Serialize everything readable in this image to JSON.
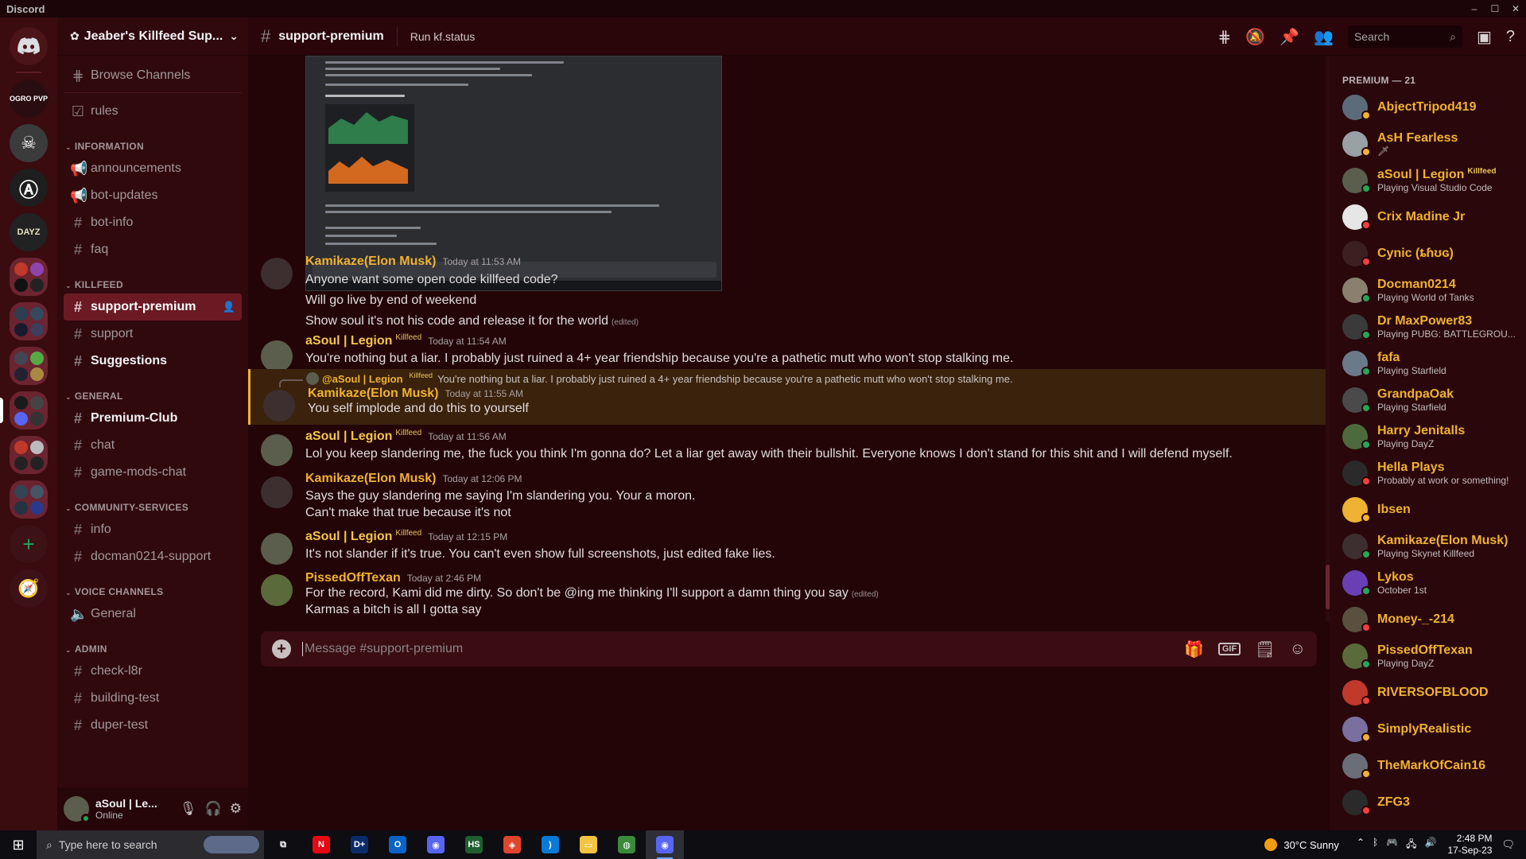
{
  "window": {
    "title": "Discord",
    "controls": [
      "–",
      "☐",
      "✕"
    ]
  },
  "servers": [
    {
      "name": "home",
      "label": ""
    },
    {
      "name": "ogro-pvp",
      "label": "OGRO PVP",
      "color": "#2a0d10"
    },
    {
      "name": "skull-server",
      "label": "",
      "color": "#3b3b3b"
    },
    {
      "name": "anarchy-server",
      "label": "Ⓐ",
      "color": "#1e1e1e"
    },
    {
      "name": "dayz-multifocx",
      "label": "DAYZ",
      "color": "#222"
    }
  ],
  "guild": {
    "name": "Jeaber's Killfeed Sup..."
  },
  "sidebar": {
    "browse": "Browse Channels",
    "top_channels": [
      {
        "name": "rules",
        "icon": "rules-icon"
      }
    ],
    "categories": [
      {
        "name": "INFORMATION",
        "channels": [
          {
            "name": "announcements",
            "icon": "megaphone-icon",
            "bold": false
          },
          {
            "name": "bot-updates",
            "icon": "megaphone-icon",
            "bold": false
          },
          {
            "name": "bot-info",
            "icon": "hash-icon",
            "bold": false
          },
          {
            "name": "faq",
            "icon": "hash-icon",
            "bold": false
          }
        ]
      },
      {
        "name": "KILLFEED",
        "channels": [
          {
            "name": "support-premium",
            "icon": "hash-icon",
            "active": true
          },
          {
            "name": "support",
            "icon": "hash-icon",
            "bold": false
          },
          {
            "name": "Suggestions",
            "icon": "hash-icon",
            "bold": true
          }
        ]
      },
      {
        "name": "GENERAL",
        "channels": [
          {
            "name": "Premium-Club",
            "icon": "hash-icon",
            "bold": true
          },
          {
            "name": "chat",
            "icon": "hash-icon",
            "bold": false
          },
          {
            "name": "game-mods-chat",
            "icon": "hash-icon",
            "bold": false
          }
        ]
      },
      {
        "name": "COMMUNITY-SERVICES",
        "channels": [
          {
            "name": "info",
            "icon": "hash-icon",
            "bold": false
          },
          {
            "name": "docman0214-support",
            "icon": "hash-icon",
            "bold": false
          }
        ]
      },
      {
        "name": "VOICE CHANNELS",
        "channels": [
          {
            "name": "General",
            "icon": "speaker-icon",
            "bold": false
          }
        ]
      },
      {
        "name": "ADMIN",
        "channels": [
          {
            "name": "check-l8r",
            "icon": "hash-icon",
            "bold": false
          },
          {
            "name": "building-test",
            "icon": "hash-icon",
            "bold": false
          },
          {
            "name": "duper-test",
            "icon": "hash-icon",
            "bold": false
          }
        ]
      }
    ]
  },
  "user_panel": {
    "name": "aSoul | Le...",
    "status": "Online"
  },
  "topbar": {
    "channel": "support-premium",
    "topic": "Run kf.status",
    "search_placeholder": "Search"
  },
  "messages": [
    {
      "author": "Kamikaze(Elon Musk)",
      "tag": "",
      "time": "Today at 11:53 AM",
      "lines": [
        "Anyone want some open code killfeed code?",
        "Will go live by end of weekend",
        "Show soul it's not his code and release it for the world"
      ],
      "edited_line": 2,
      "edited_label": "(edited)"
    },
    {
      "author": "aSoul | Legion",
      "tag": "Killfeed",
      "time": "Today at 11:54 AM",
      "lines": [
        "You're nothing but a liar. I probably just ruined a 4+ year friendship because you're a pathetic mutt who won't stop stalking me."
      ]
    },
    {
      "author": "Kamikaze(Elon Musk)",
      "tag": "",
      "time": "Today at 11:55 AM",
      "reply": {
        "author": "@aSoul | Legion",
        "tag": "Killfeed",
        "text": "You're nothing but a liar. I probably just ruined a 4+ year friendship because you're a pathetic mutt who won't stop stalking me."
      },
      "lines": [
        "You self implode and do this to yourself"
      ]
    },
    {
      "author": "aSoul | Legion",
      "tag": "Killfeed",
      "time": "Today at 11:56 AM",
      "lines": [
        "Lol you keep slandering me, the fuck you think I'm gonna do? Let a liar get away with their bullshit. Everyone knows I don't stand for this shit and I will defend myself."
      ]
    },
    {
      "author": "Kamikaze(Elon Musk)",
      "tag": "",
      "time": "Today at 12:06 PM",
      "lines": [
        "Says the guy slandering me saying I'm slandering you. Your a moron.",
        "Can't make that true because it's not"
      ]
    },
    {
      "author": "aSoul | Legion",
      "tag": "Killfeed",
      "time": "Today at 12:15 PM",
      "lines": [
        "It's not slander if it's true. You can't even show full screenshots, just edited fake lies."
      ]
    },
    {
      "author": "PissedOffTexan",
      "tag": "",
      "time": "Today at 2:46 PM",
      "lines": [
        "For the record, Kami did me dirty. So don't be @ing me thinking I'll support a damn thing you say",
        "Karmas a bitch is all I gotta say"
      ],
      "edited_line": 0,
      "edited_label": "(edited)"
    }
  ],
  "composer": {
    "placeholder": "Message #support-premium",
    "gif_label": "GIF"
  },
  "members": {
    "group": "PREMIUM — 21",
    "list": [
      {
        "name": "AbjectTripod419",
        "activity": "",
        "status": "#f0b232",
        "avatar": "#5c6b7a"
      },
      {
        "name": "AsH Fearless",
        "activity": "🗡",
        "status": "#f0b232",
        "avatar": "#9aa0a8"
      },
      {
        "name": "aSoul | Legion",
        "tag": "Killfeed",
        "activity": "Playing Visual Studio Code",
        "status": "#23a55a",
        "avatar": "#5b5e4c"
      },
      {
        "name": "Crix Madine Jr",
        "activity": "",
        "status": "#f23f43",
        "avatar": "#e6e6e6"
      },
      {
        "name": "Cynic (ȶɦʊɢ)",
        "activity": "",
        "status": "#f23f43",
        "avatar": "#3c2020"
      },
      {
        "name": "Docman0214",
        "activity": "Playing World of Tanks",
        "status": "#23a55a",
        "avatar": "#8a8070"
      },
      {
        "name": "Dr MaxPower83",
        "activity": "Playing PUBG: BATTLEGROU...",
        "status": "#23a55a",
        "avatar": "#3a3a3a"
      },
      {
        "name": "fafa",
        "activity": "Playing Starfield",
        "status": "#23a55a",
        "avatar": "#6a7a8a"
      },
      {
        "name": "GrandpaOak",
        "activity": "Playing Starfield",
        "status": "#23a55a",
        "avatar": "#4a4a4a"
      },
      {
        "name": "Harry Jenitalls",
        "activity": "Playing DayZ",
        "status": "#23a55a",
        "avatar": "#4c6a3c"
      },
      {
        "name": "Hella Plays",
        "activity": "Probably at work or something!",
        "status": "#f23f43",
        "avatar": "#2a2a2a"
      },
      {
        "name": "Ibsen",
        "activity": "",
        "status": "#f0b232",
        "avatar": "#f0b232"
      },
      {
        "name": "Kamikaze(Elon Musk)",
        "activity": "Playing Skynet Killfeed",
        "status": "#23a55a",
        "avatar": "#3d2f2f"
      },
      {
        "name": "Lykos",
        "activity": "October 1st",
        "status": "#23a55a",
        "avatar": "#6a3fb5"
      },
      {
        "name": "Money-_-214",
        "activity": "",
        "status": "#f23f43",
        "avatar": "#5a5040"
      },
      {
        "name": "PissedOffTexan",
        "activity": "Playing DayZ",
        "status": "#23a55a",
        "avatar": "#5a6a3a"
      },
      {
        "name": "RIVERSOFBLOOD",
        "activity": "",
        "status": "#f23f43",
        "avatar": "#c0392b"
      },
      {
        "name": "SimplyRealistic",
        "activity": "",
        "status": "#f0b232",
        "avatar": "#7a70a0"
      },
      {
        "name": "TheMarkOfCain16",
        "activity": "",
        "status": "#f0b232",
        "avatar": "#6a6e78"
      },
      {
        "name": "ZFG3",
        "activity": "",
        "status": "#f23f43",
        "avatar": "#2a2a2a"
      }
    ]
  },
  "taskbar": {
    "search_placeholder": "Type here to search",
    "weather": "30°C  Sunny",
    "time": "2:48 PM",
    "date": "17-Sep-23",
    "apps": [
      {
        "name": "task-view",
        "label": "⧉",
        "color": "transparent"
      },
      {
        "name": "netflix",
        "label": "N",
        "color": "#e50914"
      },
      {
        "name": "disney-plus",
        "label": "D+",
        "color": "#0b2c6b"
      },
      {
        "name": "outlook",
        "label": "O",
        "color": "#0a64c8"
      },
      {
        "name": "discord",
        "label": "◉",
        "color": "#5865f2"
      },
      {
        "name": "hs-app",
        "label": "HS",
        "color": "#1f5f2f"
      },
      {
        "name": "git-app",
        "label": "◈",
        "color": "#e0452e"
      },
      {
        "name": "vscode",
        "label": "⟩",
        "color": "#0a7ad6"
      },
      {
        "name": "file-explorer",
        "label": "▭",
        "color": "#f5c342"
      },
      {
        "name": "chrome",
        "label": "◍",
        "color": "#3a8a3a"
      },
      {
        "name": "discord-active",
        "label": "◉",
        "color": "#5865f2"
      }
    ]
  }
}
